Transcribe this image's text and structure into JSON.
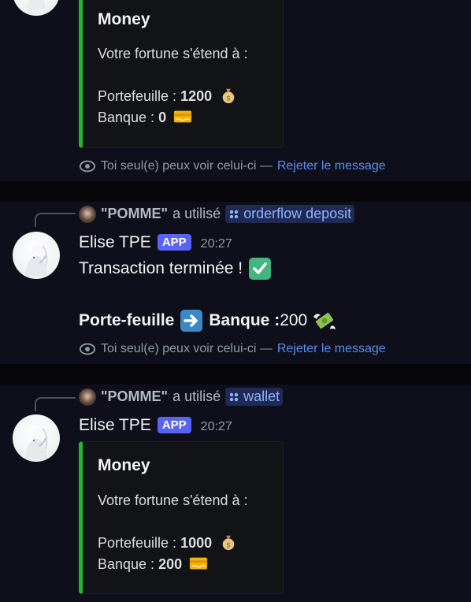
{
  "message1": {
    "embed": {
      "title": "Money",
      "line1": "Votre fortune s'étend à :",
      "wallet_label": "Portefeuille : ",
      "wallet_value": "1200",
      "bank_label": "Banque : ",
      "bank_value": "0"
    },
    "ephemeral_text": "Toi seul(e) peux voir celui-ci —",
    "dismiss_label": "Rejeter le message"
  },
  "message2": {
    "reply_user": "\"POMME\"",
    "reply_used": "a utilisé",
    "command": "orderflow deposit",
    "author": "Elise TPE",
    "badge": "APP",
    "time": "20:27",
    "line1": "Transaction terminée !",
    "transfer_from": "Porte-feuille",
    "transfer_to": "Banque :",
    "transfer_amount": " 200",
    "ephemeral_text": "Toi seul(e) peux voir celui-ci —",
    "dismiss_label": "Rejeter le message"
  },
  "message3": {
    "reply_user": "\"POMME\"",
    "reply_used": "a utilisé",
    "command": "wallet",
    "author": "Elise TPE",
    "badge": "APP",
    "time": "20:27",
    "embed": {
      "title": "Money",
      "line1": "Votre fortune s'étend à :",
      "wallet_label": "Portefeuille : ",
      "wallet_value": "1000",
      "bank_label": "Banque : ",
      "bank_value": "200"
    }
  },
  "colors": {
    "embed_accent": "#22b62c",
    "app_badge": "#5865f2",
    "link": "#5b8def",
    "command_bg": "#1f2a55"
  }
}
